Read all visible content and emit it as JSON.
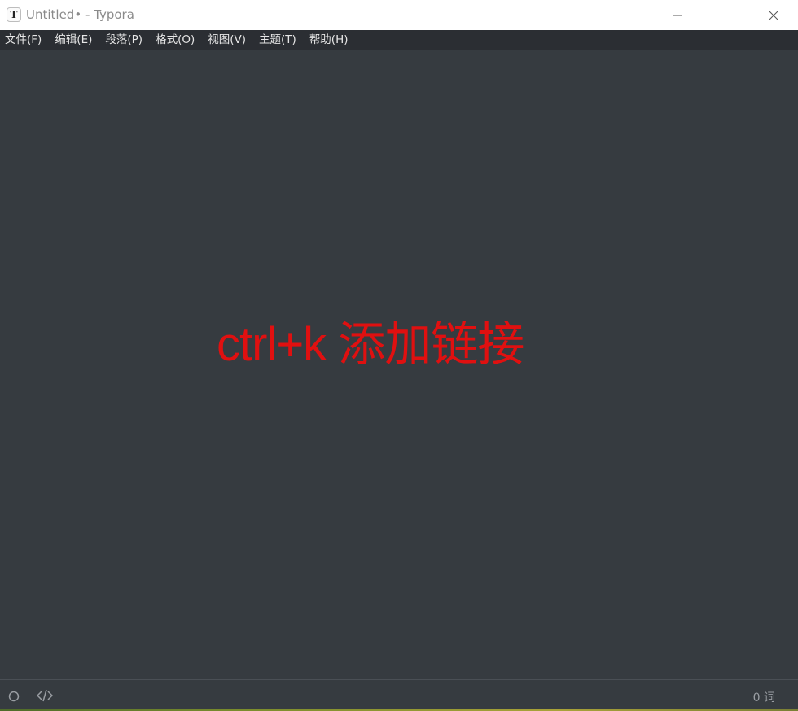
{
  "window": {
    "app_icon_letter": "T",
    "title": "Untitled• - Typora"
  },
  "menu": {
    "items": [
      "文件(F)",
      "编辑(E)",
      "段落(P)",
      "格式(O)",
      "视图(V)",
      "主题(T)",
      "帮助(H)"
    ]
  },
  "editor": {
    "overlay_latin": "ctrl+k",
    "overlay_cjk": "添加链接",
    "overlay_color": "#e01010"
  },
  "status": {
    "word_count": "0 词"
  },
  "colors": {
    "editor_bg": "#363b40",
    "menubar_bg": "#2b2e33"
  },
  "icons": {
    "outline_toggle": "circle-icon",
    "source_mode": "code-icon"
  }
}
